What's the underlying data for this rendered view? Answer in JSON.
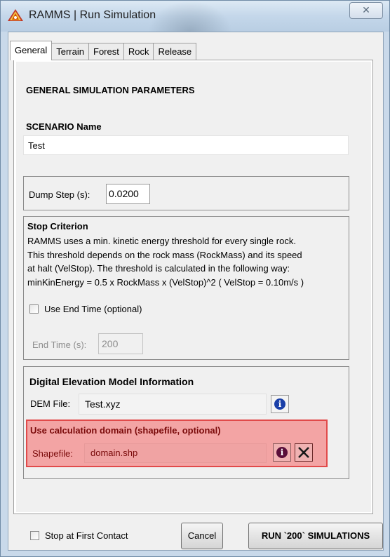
{
  "window": {
    "title": "RAMMS | Run Simulation",
    "close_label": "✕"
  },
  "tabs": [
    "General",
    "Terrain",
    "Forest",
    "Rock",
    "Release"
  ],
  "general": {
    "header": "GENERAL SIMULATION PARAMETERS",
    "scenario_label": "SCENARIO Name",
    "scenario_value": "Test"
  },
  "dump": {
    "label": "Dump Step (s):",
    "value": "0.0200"
  },
  "stop": {
    "title": "Stop Criterion",
    "lines": [
      "RAMMS uses a min. kinetic energy threshold for every single rock.",
      "This threshold depends on the rock mass (RockMass) and its speed",
      "at halt (VelStop). The threshold is calculated in the following way:",
      "minKinEnergy = 0.5 x RockMass x (VelStop)^2 ( VelStop = 0.10m/s )"
    ],
    "use_end_time_label": "Use End Time (optional)",
    "use_end_time_checked": false,
    "end_time_label": "End Time (s):",
    "end_time_value": "200"
  },
  "dem": {
    "title": "Digital Elevation Model Information",
    "file_label": "DEM File:",
    "file_value": "Test.xyz",
    "info_icon": "info-icon"
  },
  "domain": {
    "title": "Use calculation domain (shapefile, optional)",
    "shapefile_label": "Shapefile:",
    "shapefile_value": "domain.shp",
    "highlight_color": "#e14a4a"
  },
  "footer": {
    "stop_first_contact_label": "Stop at First Contact",
    "stop_first_contact_checked": false,
    "cancel_label": "Cancel",
    "run_label": "RUN `200` SIMULATIONS"
  }
}
